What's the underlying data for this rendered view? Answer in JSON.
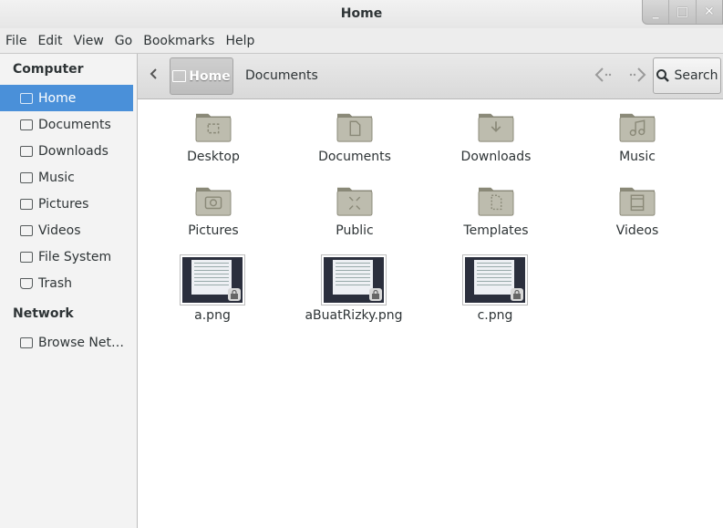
{
  "window": {
    "title": "Home"
  },
  "window_controls": {
    "minimize": "_",
    "maximize": "□",
    "close": "✕"
  },
  "menubar": [
    "File",
    "Edit",
    "View",
    "Go",
    "Bookmarks",
    "Help"
  ],
  "sidebar": {
    "computer_heading": "Computer",
    "items": [
      {
        "label": "Home",
        "icon": "home-icon",
        "active": true
      },
      {
        "label": "Documents",
        "icon": "documents-icon"
      },
      {
        "label": "Downloads",
        "icon": "downloads-icon"
      },
      {
        "label": "Music",
        "icon": "music-icon"
      },
      {
        "label": "Pictures",
        "icon": "pictures-icon"
      },
      {
        "label": "Videos",
        "icon": "videos-icon"
      },
      {
        "label": "File System",
        "icon": "filesystem-icon"
      },
      {
        "label": "Trash",
        "icon": "trash-icon"
      }
    ],
    "network_heading": "Network",
    "network_items": [
      {
        "label": "Browse Net…",
        "icon": "network-icon"
      }
    ]
  },
  "toolbar": {
    "crumb_home": "Home",
    "crumb_documents": "Documents",
    "search_label": "Search"
  },
  "files": [
    {
      "name": "Desktop",
      "type": "folder",
      "emblem": "desktop"
    },
    {
      "name": "Documents",
      "type": "folder",
      "emblem": "documents"
    },
    {
      "name": "Downloads",
      "type": "folder",
      "emblem": "downloads"
    },
    {
      "name": "Music",
      "type": "folder",
      "emblem": "music"
    },
    {
      "name": "Pictures",
      "type": "folder",
      "emblem": "pictures"
    },
    {
      "name": "Public",
      "type": "folder",
      "emblem": "public"
    },
    {
      "name": "Templates",
      "type": "folder",
      "emblem": "templates"
    },
    {
      "name": "Videos",
      "type": "folder",
      "emblem": "videos"
    },
    {
      "name": "a.png",
      "type": "image",
      "locked": true
    },
    {
      "name": "aBuatRizky.png",
      "type": "image",
      "locked": true
    },
    {
      "name": "c.png",
      "type": "image",
      "locked": true
    }
  ],
  "colors": {
    "selection": "#4a90d9",
    "folder": "#bdbcae",
    "folder_dark": "#8a8978"
  }
}
